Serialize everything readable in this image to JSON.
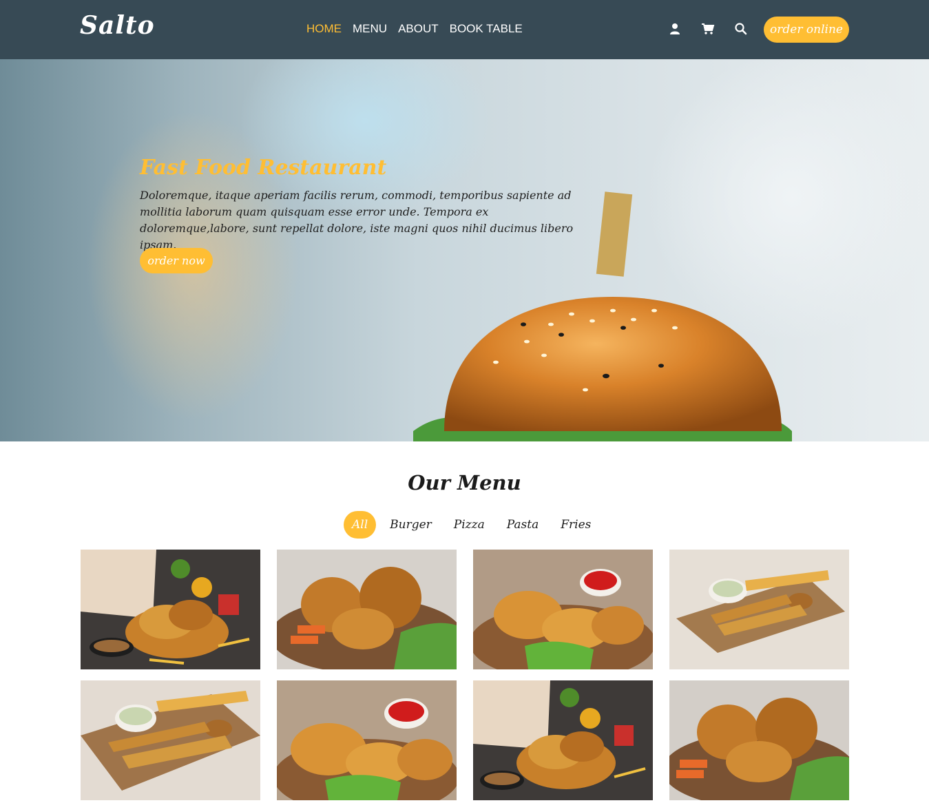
{
  "header": {
    "logo": "Salto",
    "nav": [
      {
        "label": "HOME",
        "active": true
      },
      {
        "label": "MENU",
        "active": false
      },
      {
        "label": "ABOUT",
        "active": false
      },
      {
        "label": "BOOK TABLE",
        "active": false
      }
    ],
    "icons": [
      "user-icon",
      "cart-icon",
      "search-icon"
    ],
    "order_online_label": "order online"
  },
  "hero": {
    "title": "Fast Food Restaurant",
    "text": "Doloremque, itaque aperiam facilis rerum, commodi, temporibus sapiente ad mollitia laborum quam quisquam esse error unde. Tempora ex doloremque,labore, sunt repellat dolore, iste magni quos nihil ducimus libero ipsam.",
    "button_label": "order now"
  },
  "menu": {
    "title": "Our Menu",
    "filters": [
      {
        "label": "All",
        "active": true
      },
      {
        "label": "Burger",
        "active": false
      },
      {
        "label": "Pizza",
        "active": false
      },
      {
        "label": "Pasta",
        "active": false
      },
      {
        "label": "Fries",
        "active": false
      }
    ]
  },
  "colors": {
    "header_bg": "#374a55",
    "accent": "#ffbe33"
  }
}
